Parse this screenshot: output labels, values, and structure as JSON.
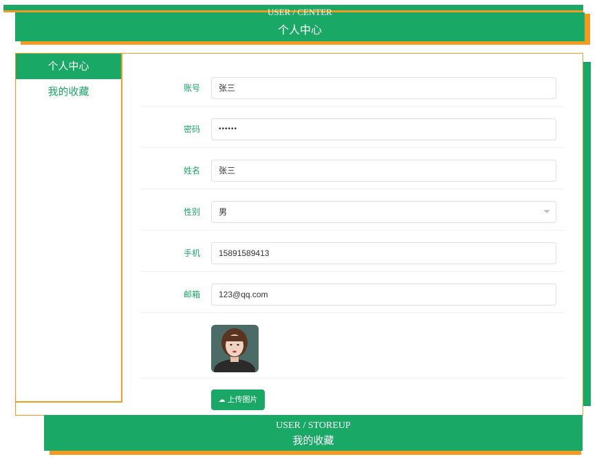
{
  "header": {
    "title_en": "USER / CENTER",
    "title_cn": "个人中心"
  },
  "sidebar": {
    "items": [
      {
        "label": "个人中心",
        "active": true
      },
      {
        "label": "我的收藏",
        "active": false
      }
    ]
  },
  "form": {
    "account": {
      "label": "账号",
      "value": "张三"
    },
    "password": {
      "label": "密码",
      "value": "••••••"
    },
    "name": {
      "label": "姓名",
      "value": "张三"
    },
    "gender": {
      "label": "性别",
      "value": "男"
    },
    "phone": {
      "label": "手机",
      "value": "15891589413"
    },
    "email": {
      "label": "邮箱",
      "value": "123@qq.com"
    },
    "upload_label": "上传图片"
  },
  "footer": {
    "title_en": "USER / STOREUP",
    "title_cn": "我的收藏"
  },
  "colors": {
    "primary": "#1aa866",
    "accent": "#f39a1f"
  },
  "icons": [
    "cloud-upload-icon",
    "chevron-down-icon"
  ]
}
